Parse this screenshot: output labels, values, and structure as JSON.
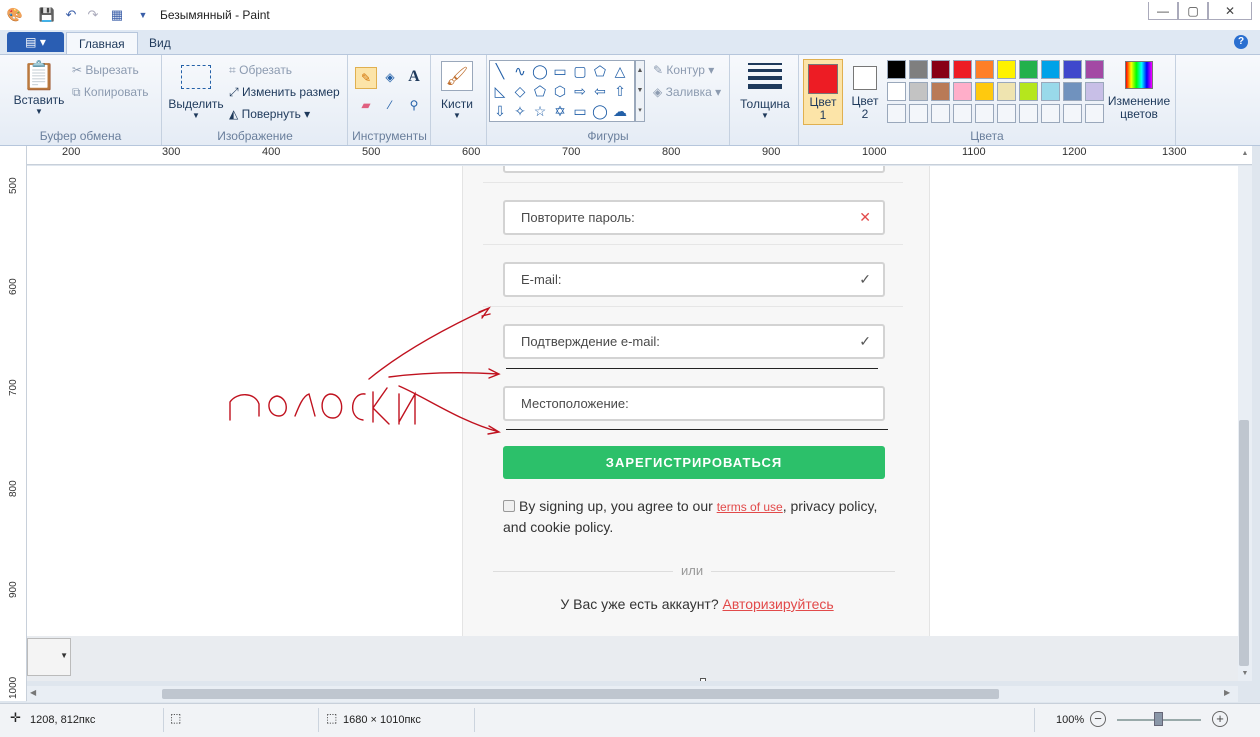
{
  "window": {
    "title": "Безымянный - Paint",
    "controls": [
      "—",
      "▢",
      "✕"
    ]
  },
  "tabs": [
    "Главная",
    "Вид"
  ],
  "ribbon": {
    "clipboard": {
      "label": "Буфер обмена",
      "paste": "Вставить",
      "cut": "Вырезать",
      "copy": "Копировать"
    },
    "image": {
      "label": "Изображение",
      "select": "Выделить",
      "crop": "Обрезать",
      "resize": "Изменить размер",
      "rotate": "Повернуть"
    },
    "tools": {
      "label": "Инструменты"
    },
    "brushes": "Кисти",
    "shapes": {
      "label": "Фигуры",
      "outline": "Контур",
      "fill": "Заливка"
    },
    "thickness": "Толщина",
    "colors": {
      "label": "Цвета",
      "color1": "Цвет 1",
      "color2": "Цвет 2",
      "edit": "Изменение цветов",
      "color1_value": "#ed1c24",
      "color2_value": "#ffffff",
      "palette_row1": [
        "#000000",
        "#7f7f7f",
        "#880015",
        "#ed1c24",
        "#ff7f27",
        "#fff200",
        "#22b14c",
        "#00a2e8",
        "#3f48cc",
        "#a349a4"
      ],
      "palette_row2": [
        "#ffffff",
        "#c3c3c3",
        "#b97a57",
        "#ffaec9",
        "#ffc90e",
        "#efe4b0",
        "#b5e61d",
        "#99d9ea",
        "#7092be",
        "#c8bfe7"
      ]
    }
  },
  "ruler": {
    "h": [
      "200",
      "300",
      "400",
      "500",
      "600",
      "700",
      "800",
      "900",
      "1000",
      "1100",
      "1200",
      "1300"
    ],
    "v": [
      "500",
      "600",
      "700",
      "800",
      "900",
      "1000"
    ]
  },
  "form": {
    "repeat_password": "Повторите пароль:",
    "email": "E-mail:",
    "confirm_email": "Подтверждение e-mail:",
    "location": "Местоположение:",
    "register": "ЗАРЕГИСТРИРОВАТЬСЯ",
    "terms_pre": "By signing up, you agree to our ",
    "terms_link": "terms of use",
    "terms_post": ", privacy policy, and cookie policy.",
    "or": "или",
    "have_account": "У Вас уже есть аккаунт? ",
    "login_link": "Авторизируйтесь"
  },
  "annotation": {
    "handwritten": "ПОЛОСКИ",
    "stroke_color": "#c0121f"
  },
  "status": {
    "cursor": "1208, 812пкс",
    "size": "1680 × 1010пкс",
    "zoom": "100%"
  }
}
